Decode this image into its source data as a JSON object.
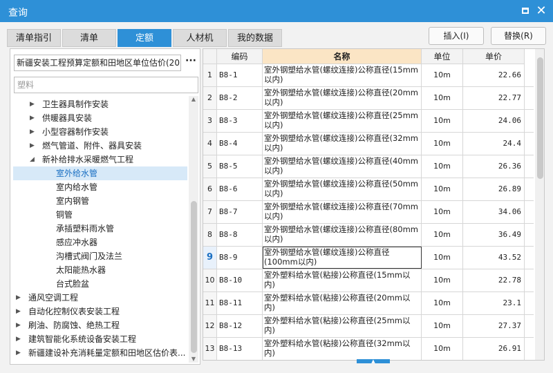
{
  "window": {
    "title": "查询"
  },
  "tabs": [
    {
      "label": "清单指引"
    },
    {
      "label": "清单"
    },
    {
      "label": "定额"
    },
    {
      "label": "人材机"
    },
    {
      "label": "我的数据"
    }
  ],
  "active_tab": "定额",
  "buttons": {
    "insert": "插入(I)",
    "replace": "替换(R)"
  },
  "left": {
    "library": "新疆安装工程预算定额和田地区单位估价(20",
    "more_label": "···",
    "search_placeholder": "塑料",
    "tree": [
      {
        "label": "卫生器具制作安装",
        "level": 1,
        "expander": "collapsed"
      },
      {
        "label": "供暖器具安装",
        "level": 1,
        "expander": "collapsed"
      },
      {
        "label": "小型容器制作安装",
        "level": 1,
        "expander": "collapsed"
      },
      {
        "label": "燃气管道、附件、器具安装",
        "level": 1,
        "expander": "collapsed"
      },
      {
        "label": "新补给排水采暖燃气工程",
        "level": 1,
        "expander": "expanded"
      },
      {
        "label": "室外给水管",
        "level": 2,
        "selected": true
      },
      {
        "label": "室内给水管",
        "level": 2
      },
      {
        "label": "室内钢管",
        "level": 2
      },
      {
        "label": "铜管",
        "level": 2
      },
      {
        "label": "承插塑料雨水管",
        "level": 2
      },
      {
        "label": "感应冲水器",
        "level": 2
      },
      {
        "label": "沟槽式阀门及法兰",
        "level": 2
      },
      {
        "label": "太阳能热水器",
        "level": 2
      },
      {
        "label": "台式脸盆",
        "level": 2
      },
      {
        "label": "通风空调工程",
        "level": 0,
        "expander": "collapsed"
      },
      {
        "label": "自动化控制仪表安装工程",
        "level": 0,
        "expander": "collapsed"
      },
      {
        "label": "刷油、防腐蚀、绝热工程",
        "level": 0,
        "expander": "collapsed"
      },
      {
        "label": "建筑智能化系统设备安装工程",
        "level": 0,
        "expander": "collapsed"
      },
      {
        "label": "新疆建设补充消耗量定额和田地区估价表...",
        "level": 0,
        "expander": "collapsed"
      }
    ]
  },
  "table": {
    "headers": {
      "code": "编码",
      "name": "名称",
      "unit": "单位",
      "price": "单价"
    },
    "current_row": 9,
    "rows": [
      {
        "idx": "1",
        "code": "B8-1",
        "name": "室外钢塑给水管(螺纹连接)公称直径(15mm以内)",
        "unit": "10m",
        "price": "22.66"
      },
      {
        "idx": "2",
        "code": "B8-2",
        "name": "室外钢塑给水管(螺纹连接)公称直径(20mm以内)",
        "unit": "10m",
        "price": "22.77"
      },
      {
        "idx": "3",
        "code": "B8-3",
        "name": "室外钢塑给水管(螺纹连接)公称直径(25mm以内)",
        "unit": "10m",
        "price": "24.06"
      },
      {
        "idx": "4",
        "code": "B8-4",
        "name": "室外钢塑给水管(螺纹连接)公称直径(32mm以内)",
        "unit": "10m",
        "price": "24.4"
      },
      {
        "idx": "5",
        "code": "B8-5",
        "name": "室外钢塑给水管(螺纹连接)公称直径(40mm以内)",
        "unit": "10m",
        "price": "26.36"
      },
      {
        "idx": "6",
        "code": "B8-6",
        "name": "室外钢塑给水管(螺纹连接)公称直径(50mm以内)",
        "unit": "10m",
        "price": "26.89"
      },
      {
        "idx": "7",
        "code": "B8-7",
        "name": "室外钢塑给水管(螺纹连接)公称直径(70mm以内)",
        "unit": "10m",
        "price": "34.06"
      },
      {
        "idx": "8",
        "code": "B8-8",
        "name": "室外钢塑给水管(螺纹连接)公称直径(80mm以内)",
        "unit": "10m",
        "price": "36.49"
      },
      {
        "idx": "9",
        "code": "B8-9",
        "name": "室外钢塑给水管(螺纹连接)公称直径(100mm以内)",
        "unit": "10m",
        "price": "43.52"
      },
      {
        "idx": "10",
        "code": "B8-10",
        "name": "室外塑料给水管(粘接)公称直径(15mm以内)",
        "unit": "10m",
        "price": "22.78"
      },
      {
        "idx": "11",
        "code": "B8-11",
        "name": "室外塑料给水管(粘接)公称直径(20mm以内)",
        "unit": "10m",
        "price": "23.1"
      },
      {
        "idx": "12",
        "code": "B8-12",
        "name": "室外塑料给水管(粘接)公称直径(25mm以内)",
        "unit": "10m",
        "price": "27.37"
      },
      {
        "idx": "13",
        "code": "B8-13",
        "name": "室外塑料给水管(粘接)公称直径(32mm以内)",
        "unit": "10m",
        "price": "26.91"
      }
    ]
  },
  "colors": {
    "accent": "#2e90d7",
    "header_highlight": "#fbe5c5",
    "selected_node": "#d7e9f8"
  }
}
